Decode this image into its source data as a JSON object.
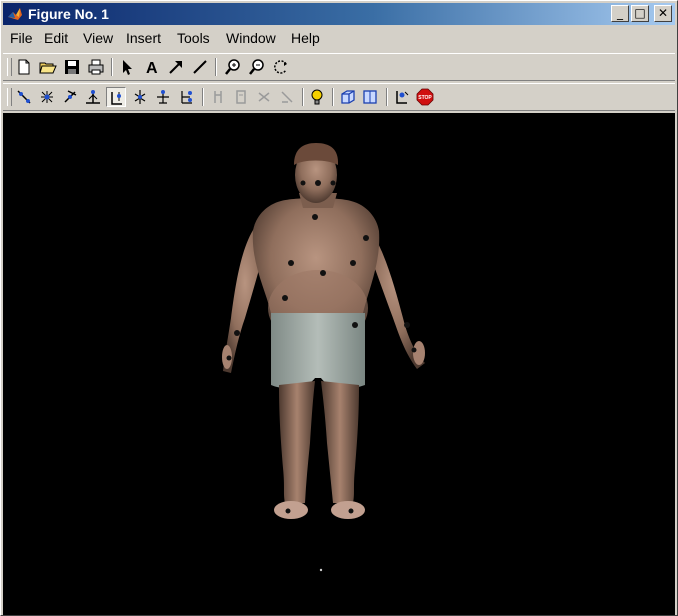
{
  "window": {
    "title": "Figure No. 1"
  },
  "titlebar_buttons": {
    "minimize": "_",
    "maximize": "□",
    "close": "✕"
  },
  "menu": [
    "File",
    "Edit",
    "View",
    "Insert",
    "Tools",
    "Window",
    "Help"
  ],
  "toolbar1": [
    {
      "icon": "new-document-icon"
    },
    {
      "icon": "open-folder-icon"
    },
    {
      "icon": "save-disk-icon"
    },
    {
      "icon": "print-icon"
    },
    {
      "icon": "select-arrow-icon"
    },
    {
      "icon": "text-a-icon",
      "glyph": "A"
    },
    {
      "icon": "draw-arrow-icon"
    },
    {
      "icon": "draw-line-icon"
    },
    {
      "icon": "zoom-in-icon"
    },
    {
      "icon": "zoom-out-icon"
    },
    {
      "icon": "rotate-3d-icon"
    }
  ],
  "toolbar2": [
    {
      "icon": "landmark-tool-1-icon"
    },
    {
      "icon": "landmark-tool-2-icon"
    },
    {
      "icon": "landmark-tool-3-icon"
    },
    {
      "icon": "landmark-tool-4-icon"
    },
    {
      "icon": "landmark-tool-5-icon",
      "pressed": true
    },
    {
      "icon": "landmark-tool-6-icon"
    },
    {
      "icon": "landmark-tool-7-icon"
    },
    {
      "icon": "landmark-tool-8-icon"
    },
    {
      "icon": "disabled-tool-1-icon"
    },
    {
      "icon": "disabled-tool-2-icon"
    },
    {
      "icon": "disabled-tool-3-icon"
    },
    {
      "icon": "disabled-tool-4-icon"
    },
    {
      "icon": "lightbulb-icon"
    },
    {
      "icon": "cube-view-icon"
    },
    {
      "icon": "box-view-icon"
    },
    {
      "icon": "tool-settings-icon"
    },
    {
      "icon": "stop-sign-icon",
      "glyph": "STOP"
    }
  ],
  "colors": {
    "titlebar_start": "#0a246a",
    "titlebar_end": "#a6caf0",
    "chrome": "#d4d0c8",
    "canvas": "#000000",
    "stop": "#d01010",
    "bulb": "#f5d000"
  }
}
